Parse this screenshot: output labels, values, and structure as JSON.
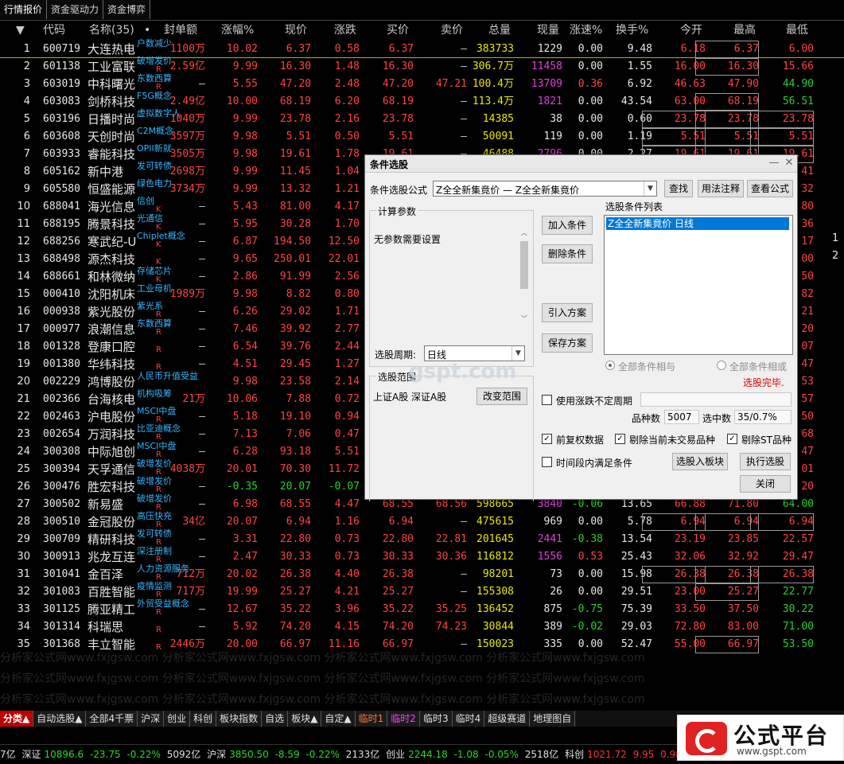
{
  "top_tabs": [
    "行情报价",
    "资金驱动力",
    "资金博弈"
  ],
  "headers": {
    "sort": "▼",
    "code": "代码",
    "name": "名称(35)",
    "dot": "•",
    "seal": "封单额",
    "pct": "涨幅%",
    "price": "现价",
    "change": "涨跌",
    "bid": "买价",
    "ask": "卖价",
    "vol": "总量",
    "curvol": "现量",
    "speed": "涨速%",
    "turnover": "换手%",
    "open": "今开",
    "high": "最高",
    "low": "最低"
  },
  "rows": [
    {
      "no": "1",
      "code": "600719",
      "name": "大连热电",
      "tag": "户数减少",
      "rk": "",
      "seal": "1100万",
      "pct": "10.02",
      "price": "6.37",
      "chg": "0.58",
      "bid": "6.37",
      "ask": "–",
      "vol": "383733",
      "cur": "1229",
      "spd": "0.00",
      "turn": "9.48",
      "open": "6.18",
      "high": "6.37",
      "low": "6.00"
    },
    {
      "no": "2",
      "code": "601138",
      "name": "工业富联",
      "tag": "破增发价",
      "rk": "R",
      "seal": "2.59亿",
      "pct": "9.99",
      "price": "16.30",
      "chg": "1.48",
      "bid": "16.30",
      "ask": "–",
      "vol": "306.7万",
      "cur": "11458",
      "spd": "0.00",
      "turn": "1.55",
      "open": "16.00",
      "high": "16.30",
      "low": "15.66"
    },
    {
      "no": "3",
      "code": "603019",
      "name": "中科曙光",
      "tag": "东数西算",
      "rk": "R",
      "seal": "–",
      "pct": "5.55",
      "price": "47.20",
      "chg": "2.48",
      "bid": "47.20",
      "ask": "47.21",
      "vol": "100.4万",
      "cur": "13709",
      "spd": "0.36",
      "turn": "6.92",
      "open": "46.63",
      "high": "47.90",
      "low": "44.90"
    },
    {
      "no": "4",
      "code": "603083",
      "name": "剑桥科技",
      "tag": "F5G概念",
      "rk": "",
      "seal": "2.49亿",
      "pct": "10.00",
      "price": "68.19",
      "chg": "6.20",
      "bid": "68.19",
      "ask": "–",
      "vol": "113.4万",
      "cur": "1821",
      "spd": "0.00",
      "turn": "43.54",
      "open": "63.00",
      "high": "68.19",
      "low": "56.51"
    },
    {
      "no": "5",
      "code": "603196",
      "name": "日播时尚",
      "tag": "虚拟数字人",
      "rk": "",
      "seal": "1040万",
      "pct": "9.99",
      "price": "23.78",
      "chg": "2.16",
      "bid": "23.78",
      "ask": "–",
      "vol": "14385",
      "cur": "38",
      "spd": "0.00",
      "turn": "0.60",
      "open": "23.78",
      "high": "23.78",
      "low": "23.78"
    },
    {
      "no": "6",
      "code": "603608",
      "name": "天创时尚",
      "tag": "C2M概念",
      "rk": "",
      "seal": "3597万",
      "pct": "9.98",
      "price": "5.51",
      "chg": "0.50",
      "bid": "5.51",
      "ask": "–",
      "vol": "50091",
      "cur": "119",
      "spd": "0.00",
      "turn": "1.19",
      "open": "5.51",
      "high": "5.51",
      "low": "5.51"
    },
    {
      "no": "7",
      "code": "603933",
      "name": "睿能科技",
      "tag": "OPII新就",
      "rk": "",
      "seal": "3505万",
      "pct": "9.98",
      "price": "19.61",
      "chg": "1.78",
      "bid": "19.61",
      "ask": "–",
      "vol": "46488",
      "cur": "2796",
      "spd": "0.00",
      "turn": "2.27",
      "open": "19.61",
      "high": "19.61",
      "low": "19.61"
    },
    {
      "no": "8",
      "code": "605162",
      "name": "新中港",
      "tag": "发可转债",
      "rk": "",
      "seal": "2698万",
      "pct": "9.99",
      "price": "11.45",
      "chg": "1.04",
      "bid": "11.45",
      "ask": "–",
      "vol": "",
      "cur": "",
      "spd": "",
      "turn": "",
      "open": "",
      "high": "",
      "low": "41"
    },
    {
      "no": "9",
      "code": "605580",
      "name": "恒盛能源",
      "tag": "绿色电力",
      "rk": "",
      "seal": "3734万",
      "pct": "9.99",
      "price": "13.32",
      "chg": "1.21",
      "bid": "",
      "ask": "",
      "vol": "",
      "cur": "",
      "spd": "",
      "turn": "",
      "open": "",
      "high": "",
      "low": "32"
    },
    {
      "no": "10",
      "code": "688041",
      "name": "海光信息",
      "tag": "信创",
      "rk": "K",
      "seal": "–",
      "pct": "5.43",
      "price": "81.00",
      "chg": "4.17",
      "bid": "",
      "ask": "",
      "vol": "",
      "cur": "",
      "spd": "",
      "turn": "",
      "open": "",
      "high": "",
      "low": "80"
    },
    {
      "no": "11",
      "code": "688195",
      "name": "腾景科技",
      "tag": "光通信",
      "rk": "K",
      "seal": "–",
      "pct": "5.95",
      "price": "30.28",
      "chg": "1.70",
      "bid": "",
      "ask": "",
      "vol": "",
      "cur": "",
      "spd": "",
      "turn": "",
      "open": "",
      "high": "",
      "low": "36"
    },
    {
      "no": "12",
      "code": "688256",
      "name": "寒武纪-U",
      "tag": "Chiplet概念",
      "rk": "K",
      "seal": "–",
      "pct": "6.87",
      "price": "194.50",
      "chg": "12.50",
      "bid": "",
      "ask": "",
      "vol": "",
      "cur": "",
      "spd": "",
      "turn": "",
      "open": "",
      "high": "",
      "low": "17"
    },
    {
      "no": "13",
      "code": "688498",
      "name": "源杰科技",
      "tag": "",
      "rk": "K",
      "seal": "–",
      "pct": "9.65",
      "price": "250.01",
      "chg": "22.01",
      "bid": "",
      "ask": "",
      "vol": "",
      "cur": "",
      "spd": "",
      "turn": "",
      "open": "",
      "high": "",
      "low": "00"
    },
    {
      "no": "14",
      "code": "688661",
      "name": "和林微纳",
      "tag": "存储芯片",
      "rk": "K",
      "seal": "–",
      "pct": "2.86",
      "price": "91.99",
      "chg": "2.56",
      "bid": "",
      "ask": "",
      "vol": "",
      "cur": "",
      "spd": "",
      "turn": "",
      "open": "",
      "high": "",
      "low": "50"
    },
    {
      "no": "15",
      "code": "000410",
      "name": "沈阳机床",
      "tag": "工业母机",
      "rk": "",
      "seal": "1989万",
      "pct": "9.98",
      "price": "8.82",
      "chg": "0.80",
      "bid": "",
      "ask": "",
      "vol": "",
      "cur": "",
      "spd": "",
      "turn": "",
      "open": "",
      "high": "",
      "low": "82"
    },
    {
      "no": "16",
      "code": "000938",
      "name": "紫光股份",
      "tag": "紫光系",
      "rk": "R",
      "seal": "–",
      "pct": "6.26",
      "price": "29.02",
      "chg": "1.71",
      "bid": "",
      "ask": "",
      "vol": "",
      "cur": "",
      "spd": "",
      "turn": "",
      "open": "",
      "high": "",
      "low": "21"
    },
    {
      "no": "17",
      "code": "000977",
      "name": "浪潮信息",
      "tag": "东数西算",
      "rk": "R",
      "seal": "–",
      "pct": "7.46",
      "price": "39.92",
      "chg": "2.77",
      "bid": "",
      "ask": "",
      "vol": "",
      "cur": "",
      "spd": "",
      "turn": "",
      "open": "",
      "high": "",
      "low": "20"
    },
    {
      "no": "18",
      "code": "001328",
      "name": "登康口腔",
      "tag": "",
      "rk": "R",
      "seal": "–",
      "pct": "6.54",
      "price": "39.76",
      "chg": "2.44",
      "bid": "",
      "ask": "",
      "vol": "",
      "cur": "",
      "spd": "",
      "turn": "",
      "open": "",
      "high": "",
      "low": "07"
    },
    {
      "no": "19",
      "code": "001380",
      "name": "华纬科技",
      "tag": "",
      "rk": "R",
      "seal": "–",
      "pct": "4.51",
      "price": "29.45",
      "chg": "1.27",
      "bid": "",
      "ask": "",
      "vol": "",
      "cur": "",
      "spd": "",
      "turn": "",
      "open": "",
      "high": "",
      "low": "47"
    },
    {
      "no": "20",
      "code": "002229",
      "name": "鸿博股份",
      "tag": "人民币升值受益",
      "rk": "",
      "seal": "",
      "pct": "9.98",
      "price": "23.58",
      "chg": "2.14",
      "bid": "",
      "ask": "",
      "vol": "",
      "cur": "",
      "spd": "",
      "turn": "",
      "open": "",
      "high": "",
      "low": "53"
    },
    {
      "no": "21",
      "code": "002366",
      "name": "台海核电",
      "tag": "机构吸筹",
      "rk": "",
      "seal": "21万",
      "pct": "10.06",
      "price": "7.88",
      "chg": "0.72",
      "bid": "",
      "ask": "",
      "vol": "",
      "cur": "",
      "spd": "",
      "turn": "",
      "open": "",
      "high": "",
      "low": "57"
    },
    {
      "no": "22",
      "code": "002463",
      "name": "沪电股份",
      "tag": "MSCI中盘",
      "rk": "R",
      "seal": "–",
      "pct": "5.18",
      "price": "19.10",
      "chg": "0.94",
      "bid": "",
      "ask": "",
      "vol": "",
      "cur": "",
      "spd": "",
      "turn": "",
      "open": "",
      "high": "",
      "low": "50"
    },
    {
      "no": "23",
      "code": "002654",
      "name": "万润科技",
      "tag": "比亚迪概念",
      "rk": "R",
      "seal": "–",
      "pct": "7.13",
      "price": "7.06",
      "chg": "0.47",
      "bid": "",
      "ask": "",
      "vol": "",
      "cur": "",
      "spd": "",
      "turn": "",
      "open": "",
      "high": "",
      "low": "68"
    },
    {
      "no": "24",
      "code": "300308",
      "name": "中际旭创",
      "tag": "MSCI中盘",
      "rk": "R",
      "seal": "–",
      "pct": "6.28",
      "price": "93.18",
      "chg": "5.51",
      "bid": "",
      "ask": "",
      "vol": "",
      "cur": "",
      "spd": "",
      "turn": "",
      "open": "",
      "high": "",
      "low": "47"
    },
    {
      "no": "25",
      "code": "300394",
      "name": "天孚通信",
      "tag": "破增发价",
      "rk": "R",
      "seal": "4038万",
      "pct": "20.01",
      "price": "70.30",
      "chg": "11.72",
      "bid": "",
      "ask": "",
      "vol": "",
      "cur": "",
      "spd": "",
      "turn": "",
      "open": "",
      "high": "",
      "low": "01"
    },
    {
      "no": "26",
      "code": "300476",
      "name": "胜宏科技",
      "tag": "破增发价",
      "rk": "R",
      "seal": "–",
      "pct": "-0.35",
      "price": "20.07",
      "chg": "-0.07",
      "bid": "",
      "ask": "",
      "vol": "",
      "cur": "",
      "spd": "",
      "turn": "",
      "open": "",
      "high": "",
      "low": "20"
    },
    {
      "no": "27",
      "code": "300502",
      "name": "新易盛",
      "tag": "破增发价",
      "rk": "R",
      "seal": "–",
      "pct": "6.98",
      "price": "68.55",
      "chg": "4.47",
      "bid": "68.55",
      "ask": "68.56",
      "vol": "598665",
      "cur": "3840",
      "spd": "-0.06",
      "turn": "13.65",
      "open": "66.88",
      "high": "71.80",
      "low": "64.00"
    },
    {
      "no": "28",
      "code": "300510",
      "name": "金冠股份",
      "tag": "高压快充",
      "rk": "R",
      "seal": "34亿",
      "pct": "20.07",
      "price": "6.94",
      "chg": "1.16",
      "bid": "6.94",
      "ask": "–",
      "vol": "475615",
      "cur": "969",
      "spd": "0.00",
      "turn": "5.78",
      "open": "6.94",
      "high": "6.94",
      "low": "6.94"
    },
    {
      "no": "29",
      "code": "300709",
      "name": "精研科技",
      "tag": "发可转债",
      "rk": "R",
      "seal": "–",
      "pct": "3.31",
      "price": "22.80",
      "chg": "0.73",
      "bid": "22.80",
      "ask": "22.81",
      "vol": "201645",
      "cur": "2441",
      "spd": "-0.38",
      "turn": "13.54",
      "open": "23.19",
      "high": "23.85",
      "low": "22.57"
    },
    {
      "no": "30",
      "code": "300913",
      "name": "兆龙互连",
      "tag": "深注册制",
      "rk": "R",
      "seal": "–",
      "pct": "2.47",
      "price": "30.33",
      "chg": "0.73",
      "bid": "30.33",
      "ask": "30.36",
      "vol": "116812",
      "cur": "1556",
      "spd": "0.53",
      "turn": "25.43",
      "open": "32.06",
      "high": "32.92",
      "low": "29.47"
    },
    {
      "no": "31",
      "code": "301041",
      "name": "金百泽",
      "tag": "人力资源服务",
      "rk": "R",
      "seal": "712万",
      "pct": "20.02",
      "price": "26.38",
      "chg": "4.40",
      "bid": "26.38",
      "ask": "–",
      "vol": "98201",
      "cur": "73",
      "spd": "0.00",
      "turn": "15.98",
      "open": "26.38",
      "high": "26.38",
      "low": "26.38"
    },
    {
      "no": "32",
      "code": "301083",
      "name": "百胜智能",
      "tag": "疫情监测",
      "rk": "R",
      "seal": "717万",
      "pct": "19.99",
      "price": "25.27",
      "chg": "4.21",
      "bid": "25.27",
      "ask": "–",
      "vol": "155308",
      "cur": "26",
      "spd": "0.00",
      "turn": "29.51",
      "open": "23.00",
      "high": "25.27",
      "low": "22.77"
    },
    {
      "no": "33",
      "code": "301125",
      "name": "腾亚精工",
      "tag": "外贸受益概念",
      "rk": "R",
      "seal": "–",
      "pct": "12.67",
      "price": "35.22",
      "chg": "3.96",
      "bid": "35.22",
      "ask": "35.25",
      "vol": "136452",
      "cur": "875",
      "spd": "-0.75",
      "turn": "75.39",
      "open": "33.50",
      "high": "37.50",
      "low": "30.22"
    },
    {
      "no": "34",
      "code": "301314",
      "name": "科瑞思",
      "tag": "",
      "rk": "R",
      "seal": "–",
      "pct": "5.92",
      "price": "74.20",
      "chg": "4.15",
      "bid": "74.20",
      "ask": "74.23",
      "vol": "30844",
      "cur": "389",
      "spd": "-0.02",
      "turn": "29.03",
      "open": "72.80",
      "high": "83.00",
      "low": "71.00"
    },
    {
      "no": "35",
      "code": "301368",
      "name": "丰立智能",
      "tag": "",
      "rk": "R",
      "seal": "2446万",
      "pct": "20.00",
      "price": "66.97",
      "chg": "11.16",
      "bid": "66.97",
      "ask": "–",
      "vol": "150023",
      "cur": "335",
      "spd": "0.00",
      "turn": "52.47",
      "open": "55.00",
      "high": "66.97",
      "low": "53.50"
    }
  ],
  "side_numbers": [
    "1",
    "2"
  ],
  "watermark": "分析家公式网www.fxjgsw.com   分析家公式网www.fxjgsw.com   分析家公式网www.fxjgsw.com   分析家公式网www.fxjgsw.com",
  "bottom_tabs": [
    "分类▲",
    "自动选股▲",
    "全部4千票",
    "沪深",
    "创业",
    "科创",
    "板块指数",
    "自选",
    "板块▲",
    "自定▲",
    "临时1",
    "临时2",
    "临时3",
    "临时4",
    "超级赛道",
    "地理图自"
  ],
  "status": {
    "prefix_amt": "7亿",
    "sz_name": "深证",
    "sz_val": "10896.6",
    "sz_chg": "-23.75",
    "sz_pct": "-0.22%",
    "sz_amt": "5092亿",
    "hs_name": "沪深",
    "hs_val": "3850.50",
    "hs_chg": "-8.59",
    "hs_pct": "-0.22%",
    "hs_amt": "2133亿",
    "cy_name": "创业",
    "cy_val": "2244.18",
    "cy_chg": "-1.08",
    "cy_pct": "-0.05%",
    "cy_amt": "2518亿",
    "kc_name": "科创",
    "kc_val": "1021.72",
    "kc_chg": "9.95",
    "kc_pct": "0.98%"
  },
  "logo": {
    "title": "公式平台",
    "url": "www.gspt.com"
  },
  "dialog_watermark": "gspt.com",
  "dialog": {
    "title": "条件选股",
    "formula_label": "条件选股公式",
    "formula_value": "Z全全新集竟价  —  Z全全新集竟价",
    "find_btn": "查找",
    "usage_btn": "用法注释",
    "view_btn": "查看公式",
    "params_group": "计算参数",
    "params_text": "无参数需要设置",
    "period_label": "选股周期:",
    "period_value": "日线",
    "add_btn": "加入条件",
    "del_btn": "删除条件",
    "import_btn": "引入方案",
    "save_btn": "保存方案",
    "list_label": "选股条件列表",
    "list_item": "Z全全新集竟价  日线",
    "radio_and": "全部条件相与",
    "radio_or": "全部条件相或",
    "done_text": "选股完毕.",
    "range_group": "选股范围",
    "range_value": "上证A股  深证A股",
    "change_range_btn": "改变范围",
    "uncertain_label": "使用涨跌不定周期",
    "count_label": "品种数",
    "count_value": "5007",
    "selected_label": "选中数",
    "selected_value": "35/0.7%",
    "prerestore_label": "前复权数据",
    "exclude_untraded_label": "剔除当前未交易品种",
    "exclude_st_label": "剔除ST品种",
    "timespan_label": "时间段内满足条件",
    "to_board_btn": "选股入板块",
    "execute_btn": "执行选股",
    "close_btn": "关闭"
  }
}
